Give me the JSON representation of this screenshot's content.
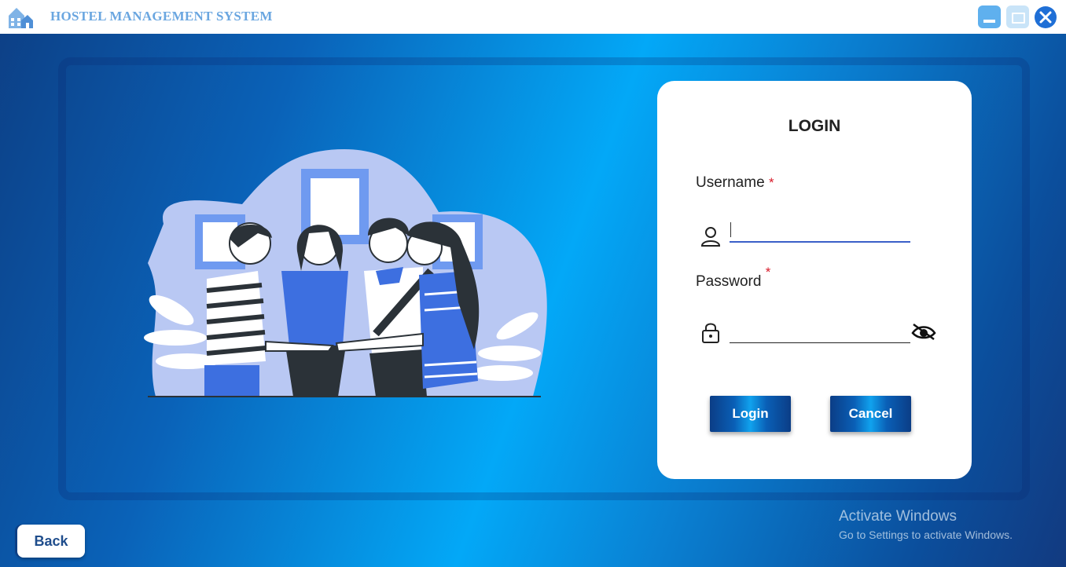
{
  "window": {
    "title": "HOSTEL MANAGEMENT SYSTEM",
    "controls": [
      "minimize-icon",
      "maximize-icon",
      "close-icon"
    ]
  },
  "login": {
    "title": "LOGIN",
    "username_label": "Username",
    "password_label": "Password",
    "required_mark": "*",
    "username_value": "",
    "password_value": "",
    "login_button": "Login",
    "cancel_button": "Cancel"
  },
  "back_button": "Back",
  "watermark": {
    "title": "Activate Windows",
    "subtitle": "Go to Settings to activate Windows."
  },
  "colors": {
    "accent": "#0a5fb6",
    "required": "#d81b2a",
    "title_text": "#6aa6e0"
  }
}
